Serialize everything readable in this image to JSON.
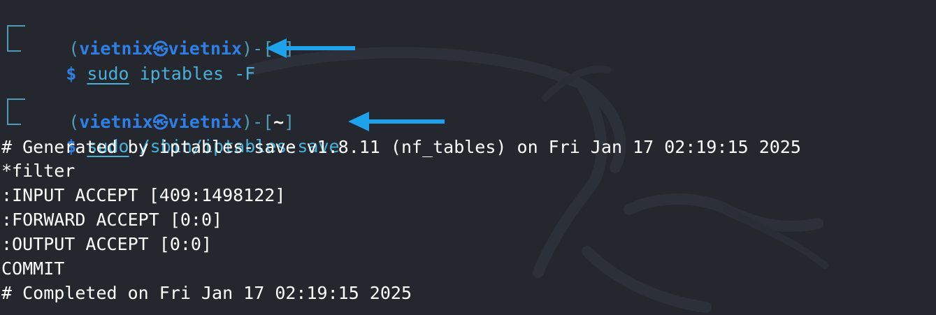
{
  "prompts": [
    {
      "open_paren": "(",
      "user": "vietnix",
      "skull": "㉿",
      "host": "vietnix",
      "close_paren": ")-[",
      "dir": "~",
      "close_bracket": "]",
      "dollar": "$",
      "sudo": "sudo",
      "command": " iptables -F"
    },
    {
      "open_paren": "(",
      "user": "vietnix",
      "skull": "㉿",
      "host": "vietnix",
      "close_paren": ")-[",
      "dir": "~",
      "close_bracket": "]",
      "dollar": "$",
      "sudo": "sudo",
      "command": " /sbin/iptables-save"
    }
  ],
  "output": [
    "# Generated by iptables-save v1.8.11 (nf_tables) on Fri Jan 17 02:19:15 2025",
    "*filter",
    ":INPUT ACCEPT [409:1498122]",
    ":FORWARD ACCEPT [0:0]",
    ":OUTPUT ACCEPT [0:0]",
    "COMMIT",
    "# Completed on Fri Jan 17 02:19:15 2025"
  ],
  "colors": {
    "background": "#24272e",
    "prompt_user": "#2f7fe6",
    "prompt_frame": "#4e9cb5",
    "command": "#4ab0d9",
    "arrow": "#1fa2ec"
  }
}
